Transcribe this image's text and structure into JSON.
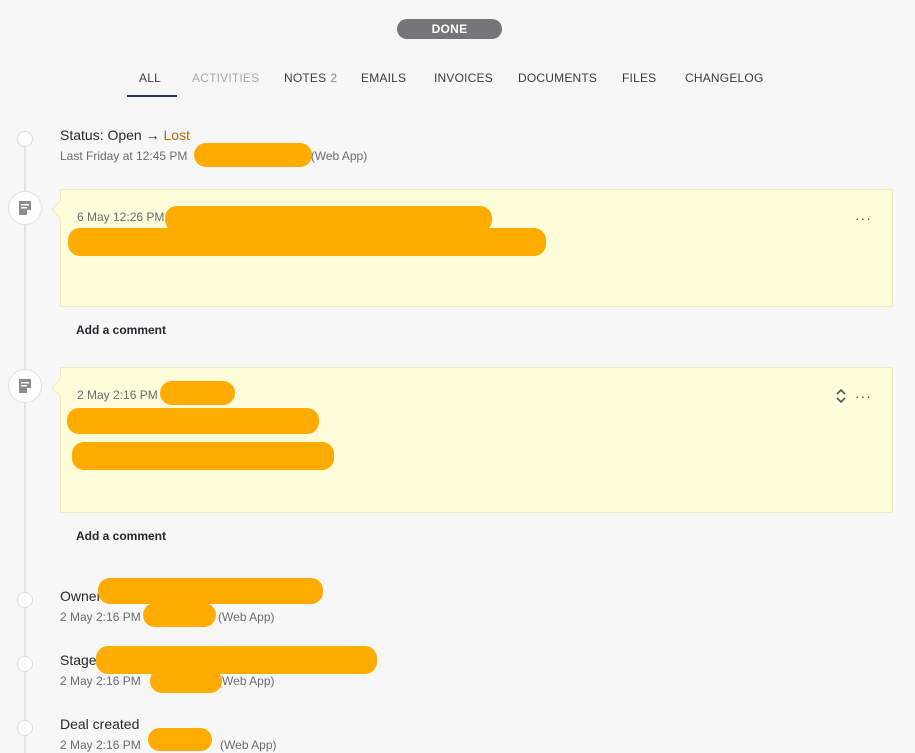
{
  "status_pill": "DONE",
  "tabs": [
    {
      "label": "ALL",
      "count": ""
    },
    {
      "label": "ACTIVITIES",
      "count": ""
    },
    {
      "label": "NOTES",
      "count": "2"
    },
    {
      "label": "EMAILS",
      "count": ""
    },
    {
      "label": "INVOICES",
      "count": ""
    },
    {
      "label": "DOCUMENTS",
      "count": ""
    },
    {
      "label": "FILES",
      "count": ""
    },
    {
      "label": "CHANGELOG",
      "count": ""
    }
  ],
  "events": {
    "status_change": {
      "prefix": "Status: Open",
      "arrow": "→",
      "new_value": "Lost",
      "time": "Last Friday at 12:45 PM",
      "source": "(Web App)"
    },
    "note1": {
      "date": "6 May 12:26 PM",
      "more": "···"
    },
    "note2": {
      "date": "2 May 2:16 PM",
      "more": "···"
    },
    "add_comment": "Add a comment",
    "owner": {
      "label": "Owner",
      "time": "2 May 2:16 PM",
      "source": "(Web App)"
    },
    "stage": {
      "label": "Stage",
      "time": "2 May 2:16 PM",
      "source": "(Web App)"
    },
    "deal_created": {
      "label": "Deal created",
      "time": "2 May 2:16 PM",
      "source": "(Web App)"
    }
  },
  "colors": {
    "lost": "#b8690a",
    "pill": "#747678",
    "note_bg": "#fffdd9",
    "tab_active": "#2b2e62",
    "redaction": "#ffab00"
  }
}
